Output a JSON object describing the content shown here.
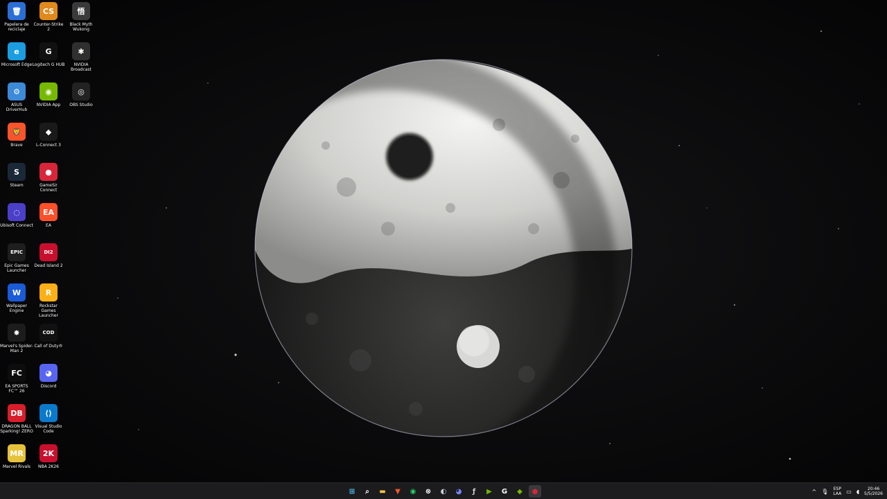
{
  "desktop": {
    "icons": [
      {
        "label": "Papelera de reciclaje",
        "glyph": "🗑",
        "bg": "#2b6fd6"
      },
      {
        "label": "Counter-Strike 2",
        "glyph": "CS",
        "bg": "#e08a1e"
      },
      {
        "label": "Black Myth Wukong",
        "glyph": "悟",
        "bg": "#3a3a3a"
      },
      {
        "label": "Microsoft Edge",
        "glyph": "e",
        "bg": "#1b9de2"
      },
      {
        "label": "Logitech G HUB",
        "glyph": "G",
        "bg": "#111111"
      },
      {
        "label": "NVIDIA Broadcast",
        "glyph": "✱",
        "bg": "#2f2f2f"
      },
      {
        "label": "ASUS DriverHub",
        "glyph": "⚙",
        "bg": "#3c8ad8"
      },
      {
        "label": "NVIDIA App",
        "glyph": "◉",
        "bg": "#76b900"
      },
      {
        "label": "OBS Studio",
        "glyph": "◎",
        "bg": "#222222"
      },
      {
        "label": "Brave",
        "glyph": "🦁",
        "bg": "#fb542b"
      },
      {
        "label": "L-Connect 3",
        "glyph": "◆",
        "bg": "#1a1a1a"
      },
      {
        "label": "",
        "glyph": "",
        "bg": "transparent"
      },
      {
        "label": "Steam",
        "glyph": "S",
        "bg": "#1b2838"
      },
      {
        "label": "GameSir Connect",
        "glyph": "●",
        "bg": "#d8253a"
      },
      {
        "label": "",
        "glyph": "",
        "bg": "transparent"
      },
      {
        "label": "Ubisoft Connect",
        "glyph": "◌",
        "bg": "#4b3fc8"
      },
      {
        "label": "EA",
        "glyph": "EA",
        "bg": "#ff4f2b"
      },
      {
        "label": "",
        "glyph": "",
        "bg": "transparent"
      },
      {
        "label": "Epic Games Launcher",
        "glyph": "EPIC",
        "bg": "#1e1e1e"
      },
      {
        "label": "Dead Island 2",
        "glyph": "DI2",
        "bg": "#c8102e"
      },
      {
        "label": "",
        "glyph": "",
        "bg": "transparent"
      },
      {
        "label": "Wallpaper Engine",
        "glyph": "W",
        "bg": "#1a5bd6"
      },
      {
        "label": "Rockstar Games Launcher",
        "glyph": "R",
        "bg": "#fcaf17"
      },
      {
        "label": "",
        "glyph": "",
        "bg": "transparent"
      },
      {
        "label": "Marvel's Spider-Man 2",
        "glyph": "✸",
        "bg": "#1c1c1c"
      },
      {
        "label": "Call of Duty®",
        "glyph": "COD",
        "bg": "#111111"
      },
      {
        "label": "",
        "glyph": "",
        "bg": "transparent"
      },
      {
        "label": "EA SPORTS FC™ 26",
        "glyph": "FC",
        "bg": "#0d0d0d"
      },
      {
        "label": "Discord",
        "glyph": "◕",
        "bg": "#5865f2"
      },
      {
        "label": "",
        "glyph": "",
        "bg": "transparent"
      },
      {
        "label": "DRAGON BALL Sparking! ZERO",
        "glyph": "DB",
        "bg": "#d81e2a"
      },
      {
        "label": "Visual Studio Code",
        "glyph": "⟨⟩",
        "bg": "#0a7acc"
      },
      {
        "label": "",
        "glyph": "",
        "bg": "transparent"
      },
      {
        "label": "Marvel Rivals",
        "glyph": "MR",
        "bg": "#e6c23a"
      },
      {
        "label": "NBA 2K26",
        "glyph": "2K",
        "bg": "#c8102e"
      }
    ]
  },
  "taskbar": {
    "apps": [
      {
        "name": "start-button",
        "glyph": "⊞",
        "color": "#4cc2ff"
      },
      {
        "name": "search-button",
        "glyph": "⌕",
        "color": "#ffffff"
      },
      {
        "name": "file-explorer-button",
        "glyph": "▬",
        "color": "#f5c542"
      },
      {
        "name": "brave-taskbar-button",
        "glyph": "▼",
        "color": "#fb542b"
      },
      {
        "name": "whatsapp-taskbar-button",
        "glyph": "◉",
        "color": "#25d366"
      },
      {
        "name": "xbox-taskbar-button",
        "glyph": "⊗",
        "color": "#ffffff"
      },
      {
        "name": "steam-taskbar-button",
        "glyph": "◐",
        "color": "#c6d4df"
      },
      {
        "name": "discord-taskbar-button",
        "glyph": "◕",
        "color": "#7b86ff"
      },
      {
        "name": "app-taskbar-button",
        "glyph": "ƒ",
        "color": "#cccccc"
      },
      {
        "name": "nvidia-broadcast-taskbar-button",
        "glyph": "▶",
        "color": "#76b900"
      },
      {
        "name": "logitech-taskbar-button",
        "glyph": "G",
        "color": "#ffffff"
      },
      {
        "name": "nvidia-app-taskbar-button",
        "glyph": "◆",
        "color": "#76b900"
      },
      {
        "name": "gamesir-taskbar-button",
        "glyph": "●",
        "color": "#d8253a",
        "active": true
      }
    ],
    "tray": {
      "chevron": "^",
      "mic": "🎙",
      "language_top": "ESP",
      "language_bottom": "LAA",
      "network": "▭",
      "volume": "◖",
      "time": "20:46",
      "date": "5/5/2026"
    }
  }
}
